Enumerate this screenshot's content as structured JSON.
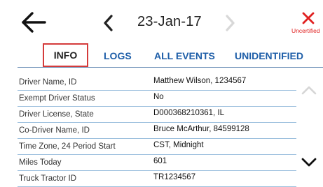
{
  "header": {
    "date": "23-Jan-17",
    "uncertified_label": "Uncertified"
  },
  "tabs": [
    {
      "label": "INFO",
      "active": true
    },
    {
      "label": "LOGS",
      "active": false
    },
    {
      "label": "ALL EVENTS",
      "active": false
    },
    {
      "label": "UNIDENTIFIED",
      "active": false
    }
  ],
  "info_rows": [
    {
      "label": "Driver Name, ID",
      "value": "Matthew Wilson, 1234567"
    },
    {
      "label": "Exempt Driver Status",
      "value": "No"
    },
    {
      "label": "Driver License, State",
      "value": "D000368210361, IL"
    },
    {
      "label": "Co-Driver Name, ID",
      "value": "Bruce McArthur, 84599128"
    },
    {
      "label": "Time Zone, 24 Period Start",
      "value": "CST, Midnight"
    },
    {
      "label": "Miles Today",
      "value": "601"
    },
    {
      "label": "Truck Tractor ID",
      "value": "TR1234567"
    }
  ],
  "colors": {
    "tab_link": "#1e5ea8",
    "active_tab_border": "#d43b3b",
    "uncertified": "#e02020",
    "row_divider": "#9dc0de"
  },
  "icons": {
    "back": "back-arrow-icon",
    "prev": "chevron-left-icon",
    "next": "chevron-right-icon",
    "uncertified": "close-x-icon",
    "scroll_up": "chevron-up-icon",
    "scroll_down": "chevron-down-icon"
  }
}
